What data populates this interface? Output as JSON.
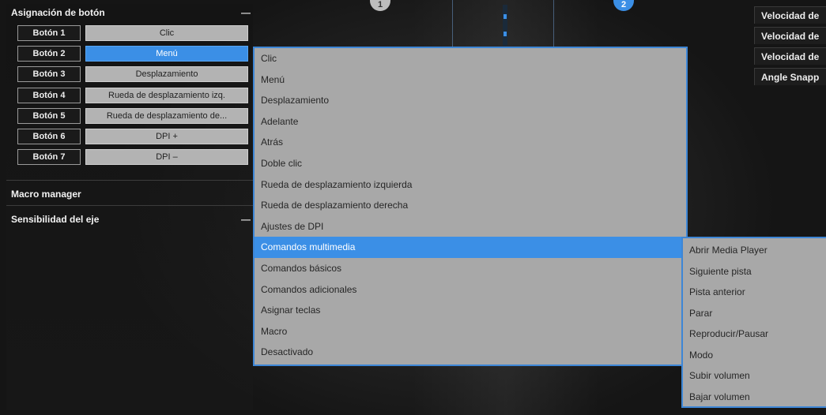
{
  "button_assignment": {
    "title": "Asignación de botón",
    "collapse_symbol": "—",
    "buttons": [
      {
        "name": "Botón 1",
        "action": "Clic",
        "active": false
      },
      {
        "name": "Botón 2",
        "action": "Menú",
        "active": true
      },
      {
        "name": "Botón 3",
        "action": "Desplazamiento",
        "active": false
      },
      {
        "name": "Botón 4",
        "action": "Rueda de desplazamiento izq.",
        "active": false
      },
      {
        "name": "Botón 5",
        "action": "Rueda de desplazamiento de...",
        "active": false
      },
      {
        "name": "Botón 6",
        "action": "DPI +",
        "active": false
      },
      {
        "name": "Botón 7",
        "action": "DPI –",
        "active": false
      }
    ]
  },
  "macro_manager": {
    "title": "Macro manager"
  },
  "axis_sensitivity": {
    "title": "Sensibilidad del eje",
    "collapse_symbol": "—"
  },
  "dropdown": {
    "items": [
      "Clic",
      "Menú",
      "Desplazamiento",
      "Adelante",
      "Atrás",
      "Doble clic",
      "Rueda de desplazamiento izquierda",
      "Rueda de desplazamiento derecha",
      "Ajustes de DPI",
      "Comandos multimedia",
      "Comandos básicos",
      "Comandos adicionales",
      "Asignar teclas",
      "Macro",
      "Desactivado"
    ],
    "active_index": 9
  },
  "submenu": {
    "items": [
      "Abrir Media Player",
      "Siguiente pista",
      "Pista anterior",
      "Parar",
      "Reproducir/Pausar",
      "Modo",
      "Subir volumen",
      "Bajar volumen"
    ]
  },
  "right_panel": {
    "items": [
      "Velocidad de",
      "Velocidad de",
      "Velocidad de",
      "Angle Snapp"
    ]
  },
  "mouse_badges": {
    "left": "1",
    "right": "2"
  },
  "colors": {
    "accent": "#3b8fe6",
    "menu_bg": "#a8a8a8"
  }
}
